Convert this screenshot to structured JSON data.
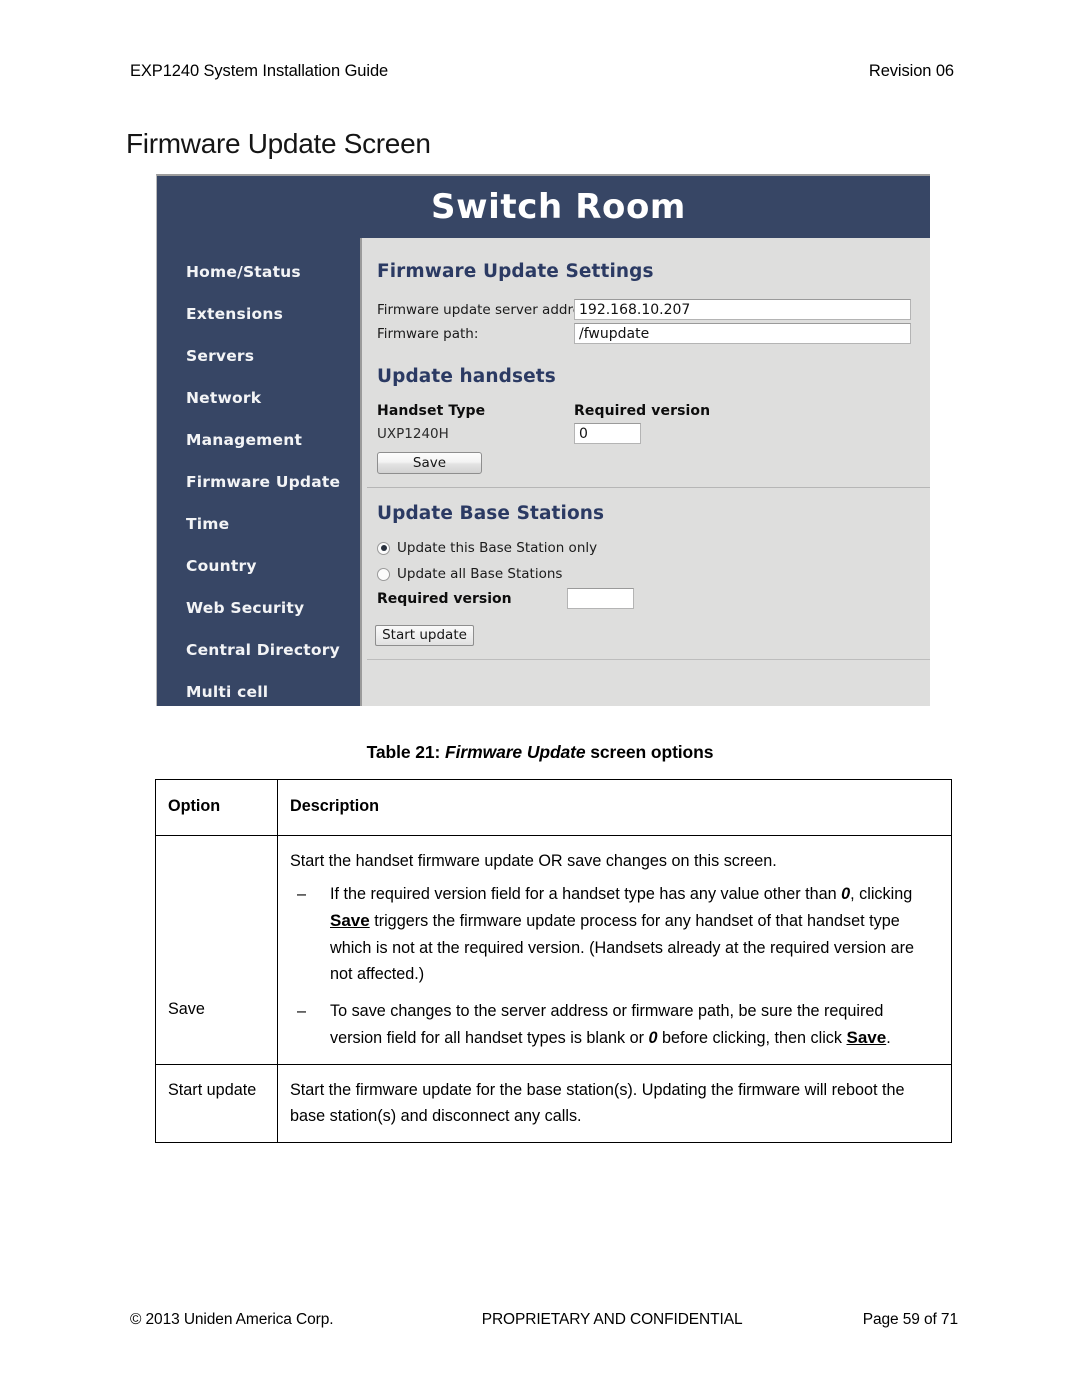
{
  "running_head": {
    "left": "EXP1240 System Installation Guide",
    "right": "Revision 06"
  },
  "page_heading": "Firmware Update Screen",
  "screenshot": {
    "app_title": "Switch Room",
    "nav_items": [
      "Home/Status",
      "Extensions",
      "Servers",
      "Network",
      "Management",
      "Firmware Update",
      "Time",
      "Country",
      "Web Security",
      "Central Directory",
      "Multi cell"
    ],
    "firmware_update_settings": {
      "section_title": "Firmware Update Settings",
      "server_address_label": "Firmware update server address:",
      "server_address_value": "192.168.10.207",
      "firmware_path_label": "Firmware path:",
      "firmware_path_value": "/fwupdate"
    },
    "update_handsets": {
      "section_title": "Update handsets",
      "col_handset_type": "Handset Type",
      "col_required_version": "Required version",
      "handset_type_value": "UXP1240H",
      "required_version_value": "0",
      "save_button": "Save"
    },
    "update_base_stations": {
      "section_title": "Update Base Stations",
      "radio_this_label": "Update this Base Station only",
      "radio_all_label": "Update all Base Stations",
      "required_version_label": "Required version",
      "required_version_value": "",
      "start_update_button": "Start update"
    },
    "colors": {
      "nav_blue": "#374665",
      "panel_gray": "#dededd",
      "section_heading_blue": "#2b3a63"
    }
  },
  "table_caption": {
    "prefix": "Table 21:",
    "italic": "Firmware Update",
    "suffix": "screen options"
  },
  "options_table": {
    "headers": [
      "Option",
      "Description"
    ],
    "rows": [
      {
        "option": "Save",
        "lead": "Start the handset firmware update OR save changes on this screen.",
        "bullets": [
          {
            "mark": "–",
            "part1": "If the required version field for a handset type has any value other than ",
            "em1": "0",
            "part2": ", clicking ",
            "strong1": "Save",
            "part3": " triggers the firmware update process for any handset of that handset type which is not at the required version. (Handsets already at the required version are not affected.)"
          },
          {
            "mark": "–",
            "part1": "To save changes to the server address or firmware path, be sure the required version field for all handset types is blank or ",
            "em1": "0",
            "part2": " before clicking, then click ",
            "strong1": "Save",
            "part3": "."
          }
        ]
      },
      {
        "option": "Start update",
        "lead": "Start the firmware update for the base station(s). Updating the firmware will reboot the base station(s) and disconnect any calls.",
        "bullets": []
      }
    ]
  },
  "footer": {
    "left": "© 2013 Uniden America Corp.",
    "middle": "PROPRIETARY AND CONFIDENTIAL",
    "right": "Page 59 of 71"
  }
}
